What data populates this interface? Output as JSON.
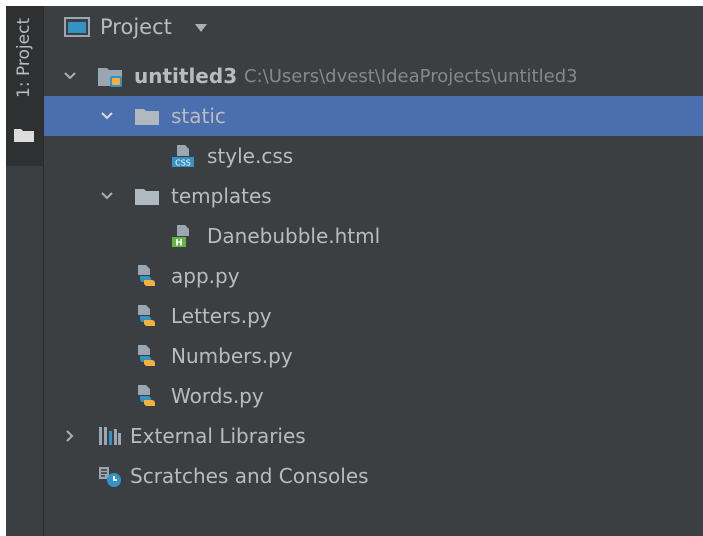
{
  "stripe": {
    "tab_label": "1: Project",
    "tab_icon": "folder-icon"
  },
  "header": {
    "title": "Project",
    "icon": "project-window-icon",
    "dropdown_icon": "caret-down-icon"
  },
  "tree": {
    "root": {
      "label": "untitled3",
      "path": "C:\\Users\\dvest\\IdeaProjects\\untitled3",
      "icon": "module-folder-icon",
      "expanded": true
    },
    "static_folder": {
      "label": "static",
      "icon": "folder-icon",
      "expanded": true,
      "selected": true
    },
    "style_css": {
      "label": "style.css",
      "icon": "css-file-icon"
    },
    "templates_folder": {
      "label": "templates",
      "icon": "folder-icon",
      "expanded": true
    },
    "danebubble_html": {
      "label": "Danebubble.html",
      "icon": "html-file-icon"
    },
    "app_py": {
      "label": "app.py",
      "icon": "python-file-icon"
    },
    "letters_py": {
      "label": "Letters.py",
      "icon": "python-file-icon"
    },
    "numbers_py": {
      "label": "Numbers.py",
      "icon": "python-file-icon"
    },
    "words_py": {
      "label": "Words.py",
      "icon": "python-file-icon"
    },
    "external_libraries": {
      "label": "External Libraries",
      "icon": "libraries-icon",
      "expanded": false
    },
    "scratches": {
      "label": "Scratches and Consoles",
      "icon": "scratches-icon"
    }
  },
  "colors": {
    "background": "#3c3f41",
    "selection": "#4b6eaf",
    "text": "#bbbbbb",
    "path_text": "#888888"
  }
}
